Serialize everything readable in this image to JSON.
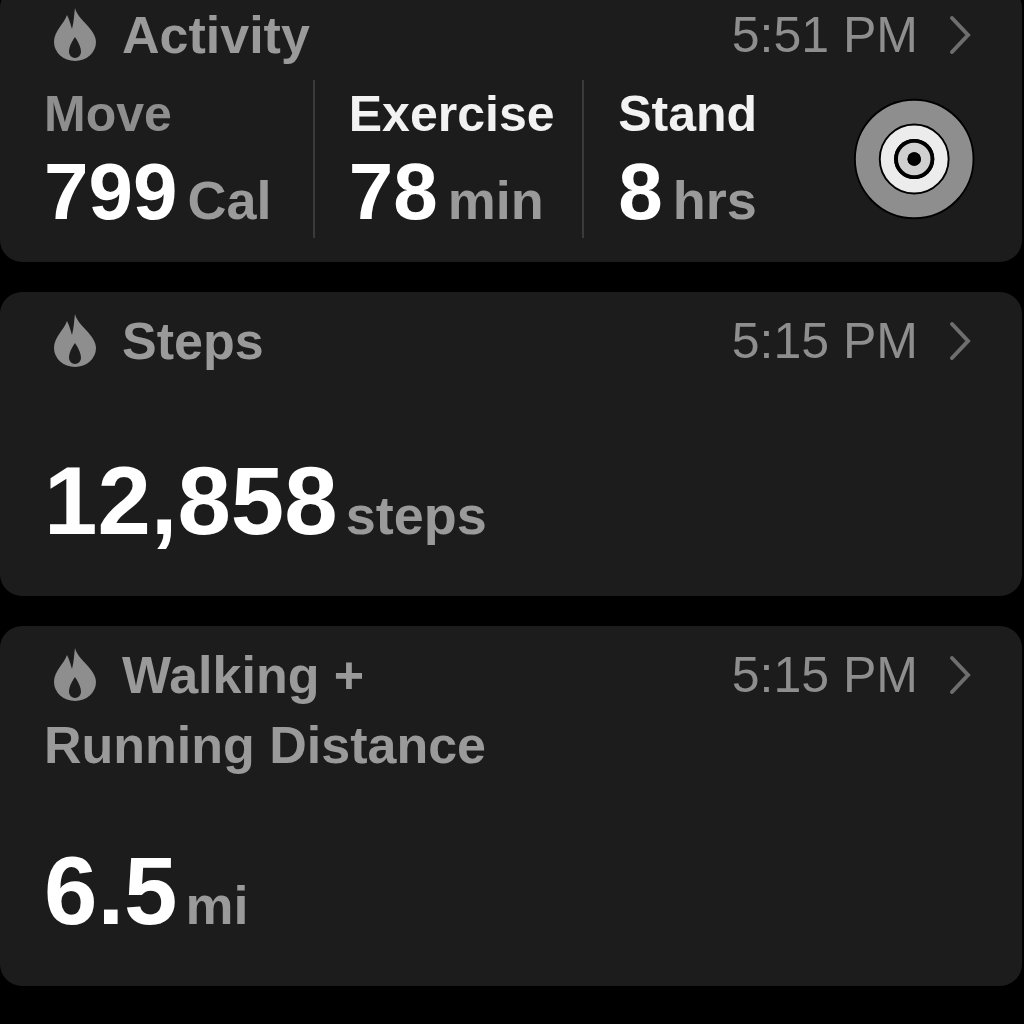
{
  "cards": [
    {
      "kind": "activity",
      "title": "Activity",
      "time": "5:51 PM",
      "metrics": [
        {
          "label": "Move",
          "value": "799",
          "unit": "Cal",
          "color": "#8e8e8e"
        },
        {
          "label": "Exercise",
          "value": "78",
          "unit": "min",
          "color": "#f2f2f2"
        },
        {
          "label": "Stand",
          "value": "8",
          "unit": "hrs",
          "color": "#f2f2f2"
        }
      ]
    },
    {
      "kind": "quantity",
      "title": "Steps",
      "time": "5:15 PM",
      "value": "12,858",
      "unit": "steps"
    },
    {
      "kind": "quantity",
      "title": "Walking + Running Distance",
      "time": "5:15 PM",
      "value": "6.5",
      "unit": "mi"
    }
  ]
}
